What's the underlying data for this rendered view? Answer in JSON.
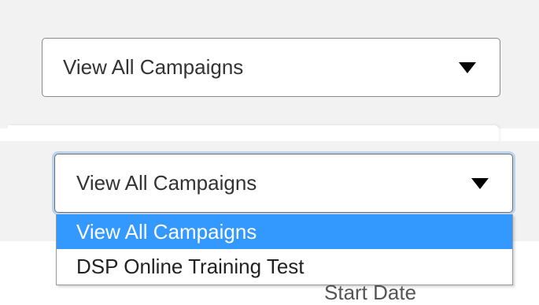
{
  "campaign_filter_top": {
    "selected": "View All Campaigns",
    "caret_icon": "triangle-down-icon"
  },
  "campaign_filter_open": {
    "selected": "View All Campaigns",
    "caret_icon": "triangle-down-icon",
    "options": [
      {
        "label": "View All Campaigns",
        "highlighted": true
      },
      {
        "label": "DSP Online Training Test",
        "highlighted": false
      }
    ]
  },
  "table": {
    "column_header": "Start Date"
  },
  "colors": {
    "option_highlight": "#3399ff",
    "focus_ring": "#bcd3ee",
    "panel_background": "#f2f2f2"
  }
}
